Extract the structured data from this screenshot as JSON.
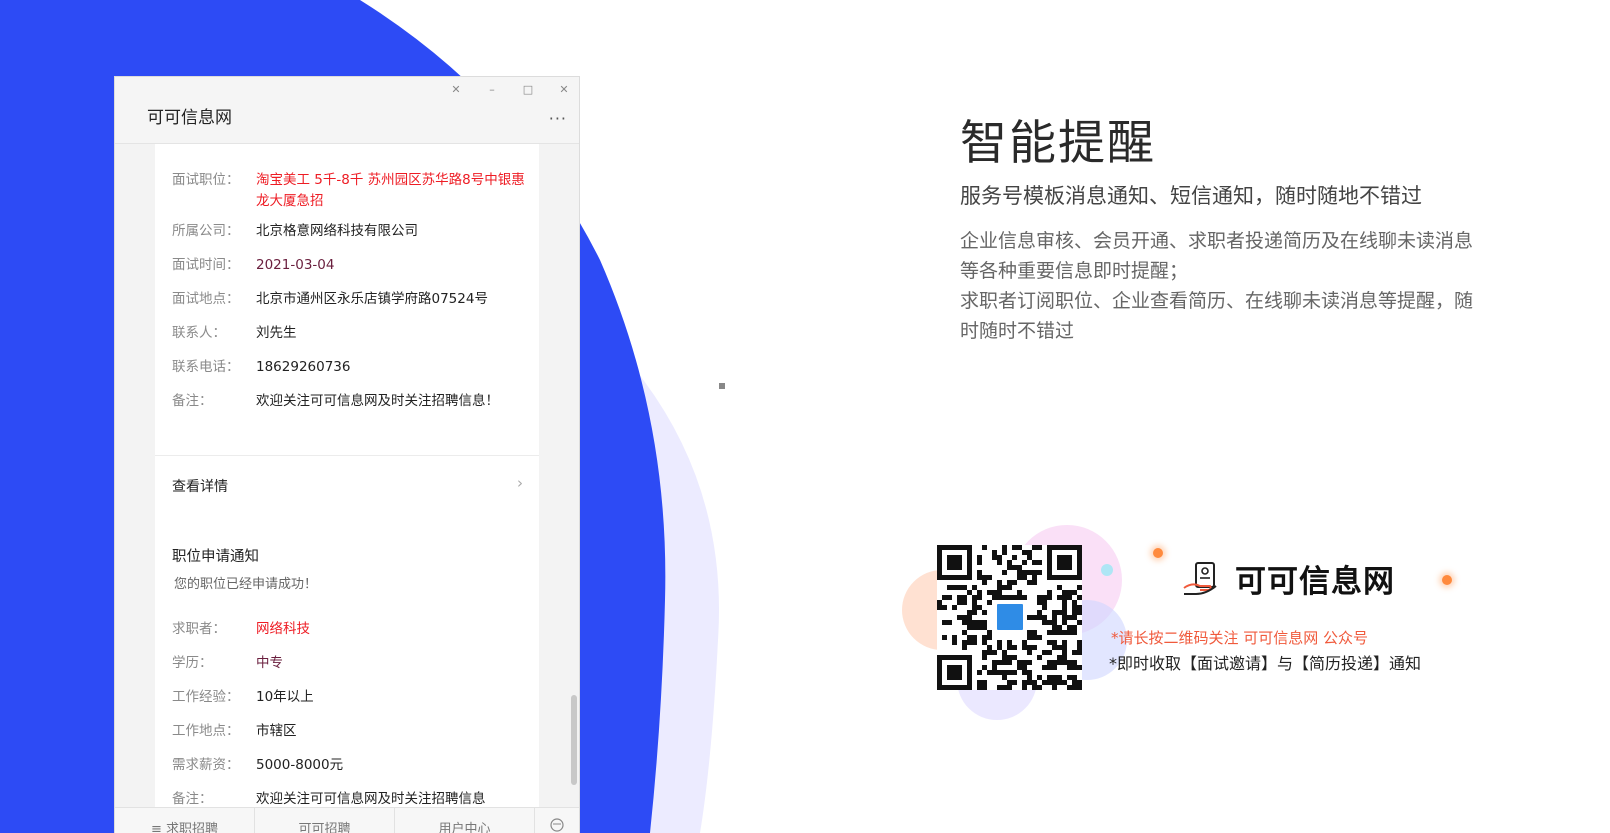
{
  "colors": {
    "accent_blue": "#2d4bf5",
    "light_purple": "#ecebff",
    "red_text": "#ee1c24",
    "tip_orange": "#f05a3c"
  },
  "window": {
    "title": "可可信息网",
    "controls": {
      "pin": "pin-icon",
      "minimize": "minimize-icon",
      "maximize": "maximize-icon",
      "close": "close-icon"
    },
    "more": "···"
  },
  "card1": {
    "rows": [
      {
        "label": "面试职位：",
        "value": "淘宝美工 5千-8千 苏州园区苏华路8号中银惠龙大厦急招"
      },
      {
        "label": "所属公司：",
        "value": "北京格意网络科技有限公司"
      },
      {
        "label": "面试时间：",
        "value": "2021-03-04"
      },
      {
        "label": "面试地点：",
        "value": "北京市通州区永乐店镇学府路07524号"
      },
      {
        "label": "联系人：",
        "value": "刘先生"
      },
      {
        "label": "联系电话：",
        "value": "18629260736"
      },
      {
        "label": "备注：",
        "value": "欢迎关注可可信息网及时关注招聘信息！"
      }
    ],
    "detail_label": "查看详情"
  },
  "card2": {
    "title": "职位申请通知",
    "subtitle": "您的职位已经申请成功！",
    "rows": [
      {
        "label": "求职者：",
        "value": "网络科技"
      },
      {
        "label": "学历：",
        "value": "中专"
      },
      {
        "label": "工作经验：",
        "value": "10年以上"
      },
      {
        "label": "工作地点：",
        "value": "市辖区"
      },
      {
        "label": "需求薪资：",
        "value": "5000-8000元"
      },
      {
        "label": "备注：",
        "value": "欢迎关注可可信息网及时关注招聘信息"
      }
    ]
  },
  "bottom_menu": {
    "item1": "≡ 求职招聘",
    "item2": "可可招聘",
    "item3": "用户中心",
    "keyboard_icon": "keyboard-icon"
  },
  "feature": {
    "title": "智能提醒",
    "subtitle": "服务号模板消息通知、短信通知，随时随地不错过",
    "desc1": "企业信息审核、会员开通、求职者投递简历及在线聊未读消息等各种重要信息即时提醒；",
    "desc2": "求职者订阅职位、企业查看简历、在线聊未读消息等提醒，随时随时不错过"
  },
  "qr": {
    "brand_name": "可可信息网",
    "tip1": "*请长按二维码关注 可可信息网 公众号",
    "tip2": "*即时收取【面试邀请】与【简历投递】通知",
    "logo_icon": "hand-document-icon"
  }
}
